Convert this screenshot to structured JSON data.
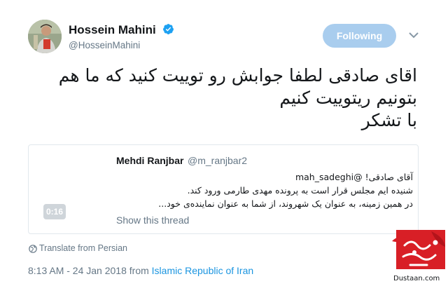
{
  "author": {
    "name": "Hossein Mahini",
    "handle": "@HosseinMahini",
    "verified_icon": "verified-badge-icon"
  },
  "follow_button": {
    "label": "Following"
  },
  "menu": {
    "icon": "chevron-down-icon"
  },
  "tweet": {
    "lines": [
      "اقای صادقی لطفا جوابش رو توییت کنید که ما هم",
      "بتونیم ریتوییت کنیم",
      "با تشکر"
    ]
  },
  "quoted_tweet": {
    "name": "Mehdi Ranjbar",
    "handle": "@m_ranjbar2",
    "lines": [
      "آقای صادقی! @mah_sadeghi",
      "شنیده ایم مجلس قرار است به پرونده مهدی طارمی ورود کند.",
      "در همین زمینه، به عنوان یک شهروند، از شما به عنوان نماینده‌ی خود..."
    ],
    "video_duration": "0:16",
    "show_thread": "Show this thread"
  },
  "translate_link": "Translate from Persian",
  "meta": {
    "time": "8:13 AM - 24 Jan 2018 from ",
    "location": "Islamic Republic of Iran"
  },
  "watermark": {
    "logo_text": "مجله دوستان",
    "site": "Dustaan.com"
  },
  "colors": {
    "link": "#1b95e0",
    "follow_button_bg": "#a9cdee",
    "secondary_text": "#657786",
    "border": "#e1e8ed",
    "logo_red": "#d81f26"
  }
}
